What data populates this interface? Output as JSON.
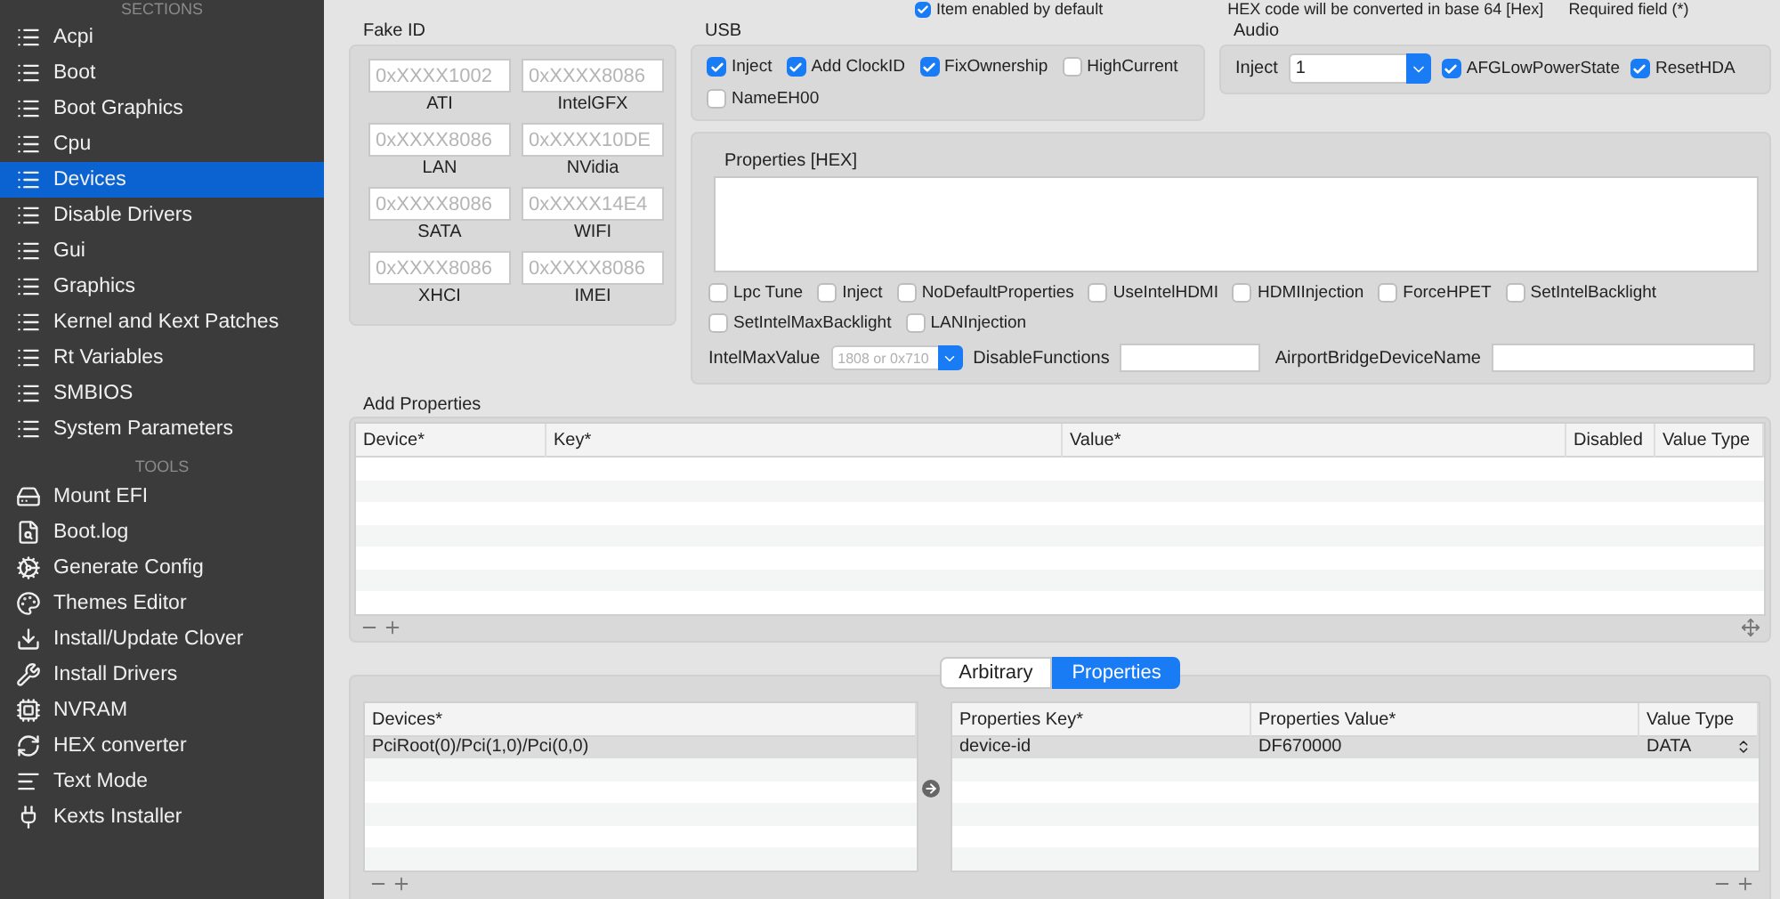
{
  "top_bar": {
    "enabled": {
      "label": "Item enabled by default",
      "checked": true
    },
    "hex_note": "HEX code will be converted in base 64 [Hex]",
    "required_note": "Required field (*)"
  },
  "sidebar": {
    "sections_heading": "SECTIONS",
    "sections": [
      {
        "label": "Acpi",
        "selected": false
      },
      {
        "label": "Boot",
        "selected": false
      },
      {
        "label": "Boot Graphics",
        "selected": false
      },
      {
        "label": "Cpu",
        "selected": false
      },
      {
        "label": "Devices",
        "selected": true
      },
      {
        "label": "Disable Drivers",
        "selected": false
      },
      {
        "label": "Gui",
        "selected": false
      },
      {
        "label": "Graphics",
        "selected": false
      },
      {
        "label": "Kernel and Kext Patches",
        "selected": false
      },
      {
        "label": "Rt Variables",
        "selected": false
      },
      {
        "label": "SMBIOS",
        "selected": false
      },
      {
        "label": "System Parameters",
        "selected": false
      }
    ],
    "tools_heading": "TOOLS",
    "tools": [
      {
        "label": "Mount EFI"
      },
      {
        "label": "Boot.log"
      },
      {
        "label": "Generate Config"
      },
      {
        "label": "Themes Editor"
      },
      {
        "label": "Install/Update Clover"
      },
      {
        "label": "Install Drivers"
      },
      {
        "label": "NVRAM"
      },
      {
        "label": "HEX converter"
      },
      {
        "label": "Text Mode"
      },
      {
        "label": "Kexts Installer"
      }
    ]
  },
  "fake_id": {
    "title": "Fake ID",
    "fields": [
      {
        "placeholder": "0xXXXX1002",
        "label": "ATI"
      },
      {
        "placeholder": "0xXXXX8086",
        "label": "IntelGFX"
      },
      {
        "placeholder": "0xXXXX8086",
        "label": "LAN"
      },
      {
        "placeholder": "0xXXXX10DE",
        "label": "NVidia"
      },
      {
        "placeholder": "0xXXXX8086",
        "label": "SATA"
      },
      {
        "placeholder": "0xXXXX14E4",
        "label": "WIFI"
      },
      {
        "placeholder": "0xXXXX8086",
        "label": "XHCI"
      },
      {
        "placeholder": "0xXXXX8086",
        "label": "IMEI"
      }
    ]
  },
  "usb": {
    "title": "USB",
    "options": [
      {
        "label": "Inject",
        "checked": true
      },
      {
        "label": "Add ClockID",
        "checked": true
      },
      {
        "label": "FixOwnership",
        "checked": true
      },
      {
        "label": "HighCurrent",
        "checked": false
      },
      {
        "label": "NameEH00",
        "checked": false
      }
    ]
  },
  "audio": {
    "title": "Audio",
    "inject_label": "Inject",
    "inject_value": "1",
    "options": [
      {
        "label": "AFGLowPowerState",
        "checked": true
      },
      {
        "label": "ResetHDA",
        "checked": true
      }
    ]
  },
  "properties_hex": {
    "title": "Properties [HEX]",
    "options": [
      {
        "label": "Lpc Tune",
        "checked": false
      },
      {
        "label": "Inject",
        "checked": false
      },
      {
        "label": "NoDefaultProperties",
        "checked": false
      },
      {
        "label": "UseIntelHDMI",
        "checked": false
      },
      {
        "label": "HDMIInjection",
        "checked": false
      },
      {
        "label": "ForceHPET",
        "checked": false
      },
      {
        "label": "SetIntelBacklight",
        "checked": false
      },
      {
        "label": "SetIntelMaxBacklight",
        "checked": false
      },
      {
        "label": "LANInjection",
        "checked": false
      }
    ],
    "intel_max_value": {
      "label": "IntelMaxValue",
      "placeholder": "1808 or 0x710"
    },
    "disable_functions": {
      "label": "DisableFunctions"
    },
    "airport_bridge": {
      "label": "AirportBridgeDeviceName"
    }
  },
  "add_properties": {
    "title": "Add Properties",
    "columns": [
      "Device*",
      "Key*",
      "Value*",
      "Disabled",
      "Value Type"
    ]
  },
  "tabs": [
    {
      "label": "Arbitrary",
      "selected": false
    },
    {
      "label": "Properties",
      "selected": true
    }
  ],
  "devices": {
    "columns": [
      "Devices*"
    ],
    "rows": [
      {
        "path": "PciRoot(0)/Pci(1,0)/Pci(0,0)",
        "selected": true
      }
    ]
  },
  "properties": {
    "columns": [
      "Properties Key*",
      "Properties Value*",
      "Value Type"
    ],
    "rows": [
      {
        "key": "device-id",
        "value": "DF670000",
        "type": "DATA",
        "selected": true
      }
    ]
  }
}
